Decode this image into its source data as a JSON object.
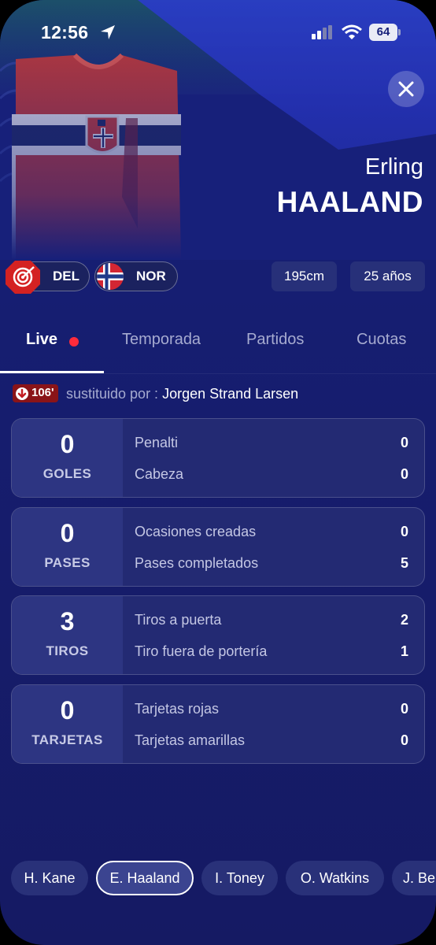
{
  "status_bar": {
    "time": "12:56",
    "battery": "64"
  },
  "player": {
    "first_name": "Erling",
    "last_name": "HAALAND"
  },
  "chips": {
    "position": "DEL",
    "nationality": "NOR",
    "height": "195cm",
    "age": "25 años"
  },
  "tabs": [
    {
      "label": "Live"
    },
    {
      "label": "Temporada"
    },
    {
      "label": "Partidos"
    },
    {
      "label": "Cuotas"
    }
  ],
  "substitution": {
    "minute": "106'",
    "label": "sustituido por :",
    "player": "Jorgen Strand Larsen"
  },
  "stats": [
    {
      "value": "0",
      "category": "GOLES",
      "rows": [
        {
          "label": "Penalti",
          "value": "0"
        },
        {
          "label": "Cabeza",
          "value": "0"
        }
      ]
    },
    {
      "value": "0",
      "category": "PASES",
      "rows": [
        {
          "label": "Ocasiones creadas",
          "value": "0"
        },
        {
          "label": "Pases completados",
          "value": "5"
        }
      ]
    },
    {
      "value": "3",
      "category": "TIROS",
      "rows": [
        {
          "label": "Tiros a puerta",
          "value": "2"
        },
        {
          "label": "Tiro fuera de portería",
          "value": "1"
        }
      ]
    },
    {
      "value": "0",
      "category": "TARJETAS",
      "rows": [
        {
          "label": "Tarjetas rojas",
          "value": "0"
        },
        {
          "label": "Tarjetas amarillas",
          "value": "0"
        }
      ]
    }
  ],
  "player_selector": [
    {
      "label": "H. Kane"
    },
    {
      "label": "E. Haaland"
    },
    {
      "label": "I. Toney"
    },
    {
      "label": "O. Watkins"
    },
    {
      "label": "J. Be"
    }
  ],
  "icons": {
    "close": "close-icon",
    "position": "target-icon",
    "flag": "norway-flag-icon",
    "substitution": "arrow-down-icon"
  },
  "colors": {
    "background": "#17207a",
    "accent_red": "#ff2b3b",
    "sub_badge": "#8a1418"
  }
}
